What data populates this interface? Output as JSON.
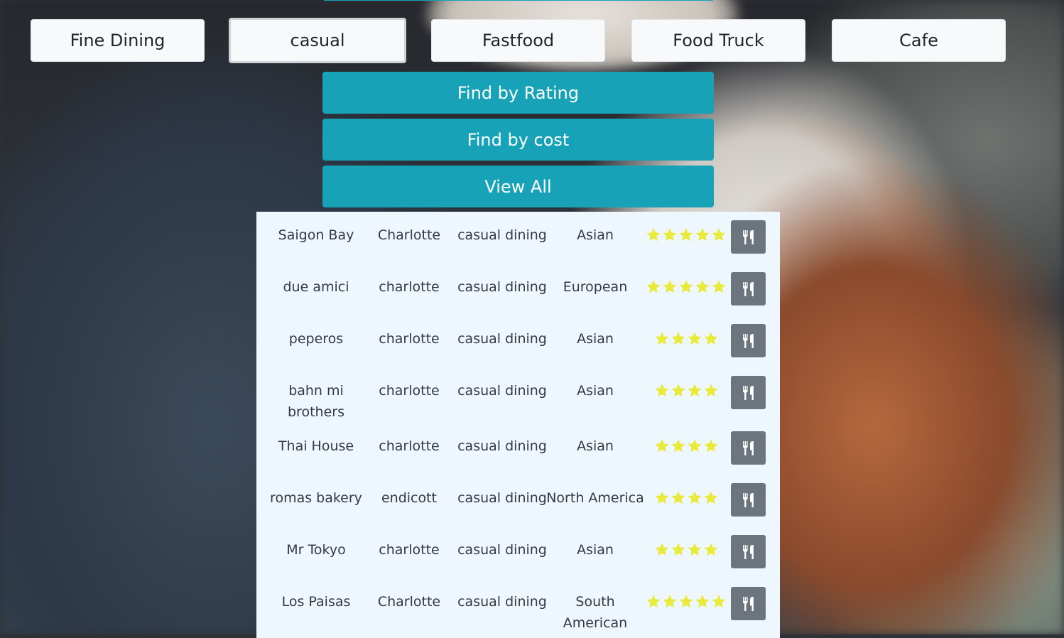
{
  "categories": [
    {
      "label": "Fine Dining"
    },
    {
      "label": "casual"
    },
    {
      "label": "Fastfood"
    },
    {
      "label": "Food Truck"
    },
    {
      "label": "Cafe"
    }
  ],
  "active_category": "casual",
  "actions": {
    "rating": "Find by Rating",
    "cost": "Find by cost",
    "view_all": "View All"
  },
  "colors": {
    "accent": "#17a2b8",
    "star": "#e8eb3b",
    "icon_button": "#6c757d",
    "panel": "#eef7fd"
  },
  "restaurants": [
    {
      "name": "Saigon Bay",
      "city": "Charlotte",
      "type": "casual dining",
      "cuisine": "Asian",
      "rating": 5,
      "icon": "utensils-icon"
    },
    {
      "name": "due amici",
      "city": "charlotte",
      "type": "casual dining",
      "cuisine": "European",
      "rating": 5,
      "icon": "utensils-icon"
    },
    {
      "name": "peperos",
      "city": "charlotte",
      "type": "casual dining",
      "cuisine": "Asian",
      "rating": 4,
      "icon": "utensils-icon"
    },
    {
      "name": "bahn mi brothers",
      "city": "charlotte",
      "type": "casual dining",
      "cuisine": "Asian",
      "rating": 4,
      "icon": "utensils-icon"
    },
    {
      "name": "Thai House",
      "city": "charlotte",
      "type": "casual dining",
      "cuisine": "Asian",
      "rating": 4,
      "icon": "utensils-icon"
    },
    {
      "name": "romas bakery",
      "city": "endicott",
      "type": "casual dining",
      "cuisine": "North America",
      "rating": 4,
      "icon": "utensils-icon"
    },
    {
      "name": "Mr Tokyo",
      "city": "charlotte",
      "type": "casual dining",
      "cuisine": "Asian",
      "rating": 4,
      "icon": "utensils-icon"
    },
    {
      "name": "Los Paisas",
      "city": "Charlotte",
      "type": "casual dining",
      "cuisine": "South American",
      "rating": 5,
      "icon": "utensils-icon"
    }
  ]
}
